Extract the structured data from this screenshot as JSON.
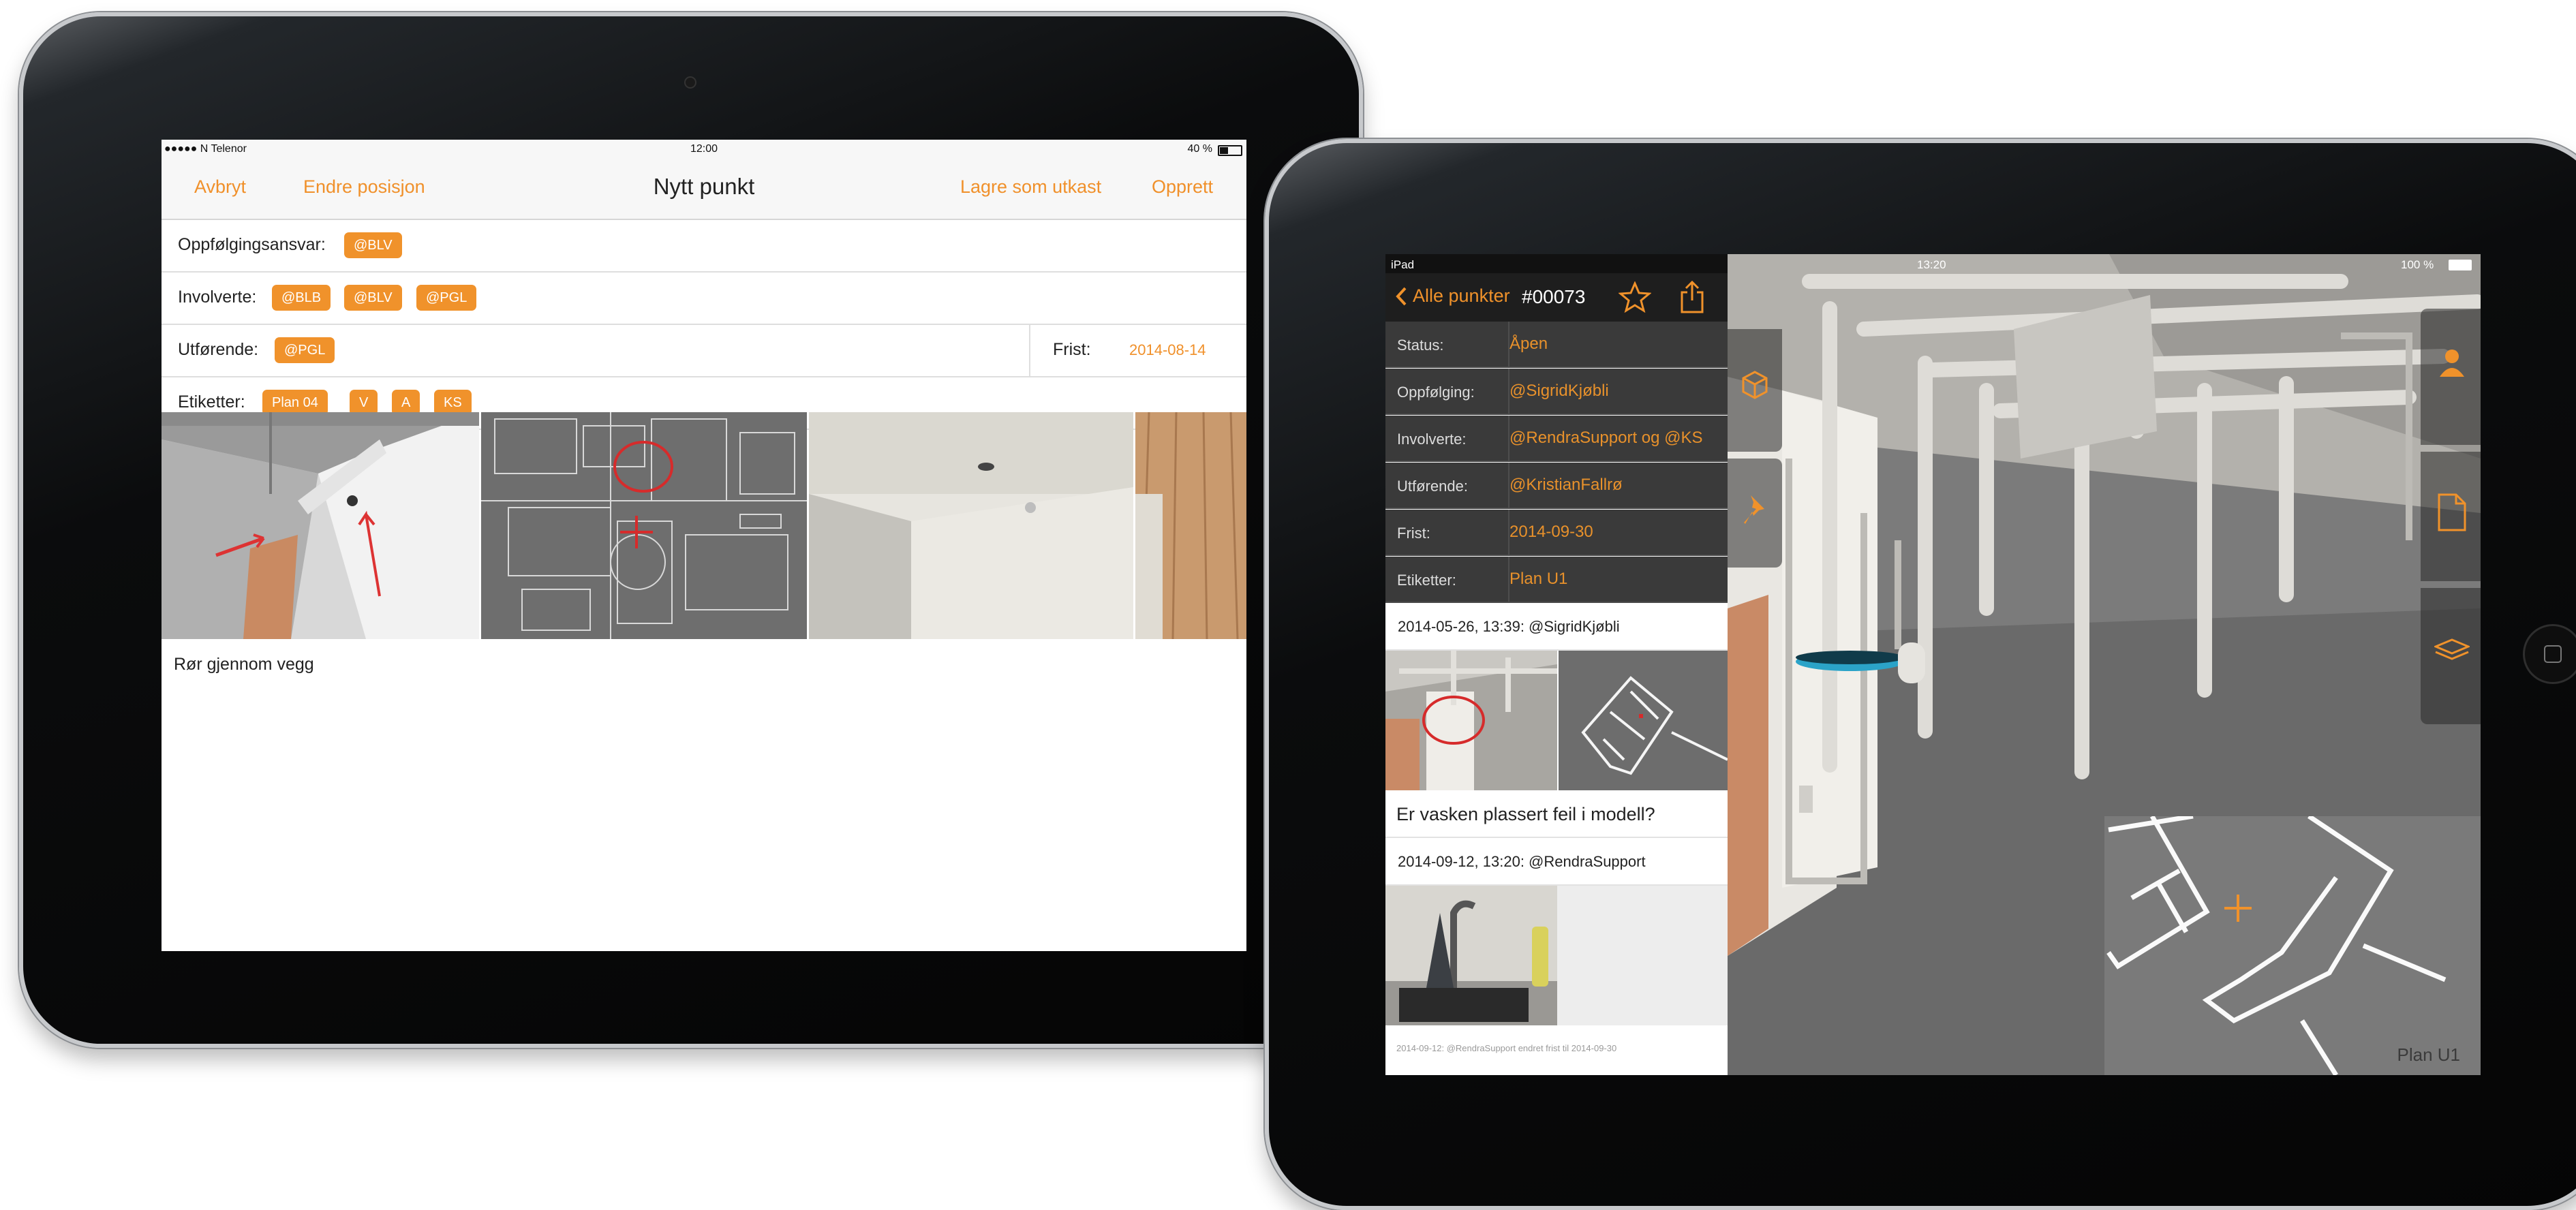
{
  "ipad1": {
    "status": {
      "carrier": "●●●●● N Telenor",
      "time": "12:00",
      "battery": "40 %"
    },
    "nav": {
      "cancel": "Avbryt",
      "change_position": "Endre posisjon",
      "title": "Nytt punkt",
      "save_draft": "Lagre som utkast",
      "create": "Opprett"
    },
    "followup": {
      "label": "Oppfølgingsansvar:",
      "tags": [
        "@BLV"
      ]
    },
    "involved": {
      "label": "Involverte:",
      "tags": [
        "@BLB",
        "@BLV",
        "@PGL"
      ]
    },
    "performer": {
      "label": "Utførende:",
      "tags": [
        "@PGL"
      ],
      "deadline_label": "Frist:",
      "deadline": "2014-08-14"
    },
    "labels": {
      "label": "Etiketter:",
      "tags": [
        "Plan 04",
        "V",
        "A",
        "KS"
      ]
    },
    "description": "Rør gjennom vegg"
  },
  "ipad2": {
    "status": {
      "device": "iPad",
      "time": "13:20",
      "battery": "100 %"
    },
    "nav": {
      "back": "Alle punkter",
      "id": "#00073"
    },
    "fields": [
      {
        "key": "Status:",
        "value": "Åpen"
      },
      {
        "key": "Oppfølging:",
        "value": "@SigridKjøbli"
      },
      {
        "key": "Involverte:",
        "value": "@RendraSupport og @KS"
      },
      {
        "key": "Utførende:",
        "value": "@KristianFallrø"
      },
      {
        "key": "Frist:",
        "value": "2014-09-30"
      },
      {
        "key": "Etiketter:",
        "value": "Plan U1"
      }
    ],
    "comments": [
      {
        "header": "2014-05-26, 13:39: @SigridKjøbli",
        "text": "Er vasken plassert feil i modell?"
      },
      {
        "header": "2014-09-12, 13:20: @RendraSupport"
      }
    ],
    "log": "2014-09-12: @RendraSupport endret frist til 2014-09-30",
    "minimap_label": "Plan U1"
  },
  "colors": {
    "accent": "#f0922b",
    "panel_dark": "#3a3a3a"
  },
  "icons": [
    "chevron-left-icon",
    "star-icon",
    "share-icon",
    "cube-icon",
    "pin-icon",
    "person-icon",
    "document-icon",
    "layers-icon",
    "home-button-icon"
  ]
}
